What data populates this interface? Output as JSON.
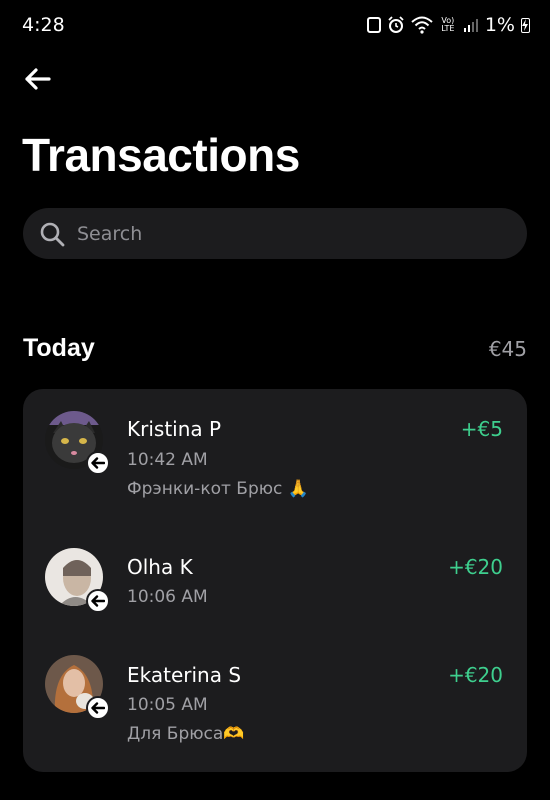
{
  "status_bar": {
    "time": "4:28",
    "volte_label": "Vo) LTE",
    "battery_percent": "1%"
  },
  "header": {
    "title": "Transactions"
  },
  "search": {
    "placeholder": "Search"
  },
  "section": {
    "title": "Today",
    "total": "€45"
  },
  "transactions": [
    {
      "name": "Kristina P",
      "time": "10:42 AM",
      "note": "Фрэнки-кот Брюс 🙏",
      "amount": "+€5",
      "direction_icon": "incoming-arrow-icon"
    },
    {
      "name": "Olha K",
      "time": "10:06 AM",
      "note": "",
      "amount": "+€20",
      "direction_icon": "incoming-arrow-icon"
    },
    {
      "name": "Ekaterina S",
      "time": "10:05 AM",
      "note": "Для Брюса🫶",
      "amount": "+€20",
      "direction_icon": "incoming-arrow-icon"
    }
  ],
  "colors": {
    "background": "#000000",
    "card": "#1c1c1e",
    "positive_amount": "#3ecf8e",
    "secondary_text": "#a0a0a5"
  }
}
